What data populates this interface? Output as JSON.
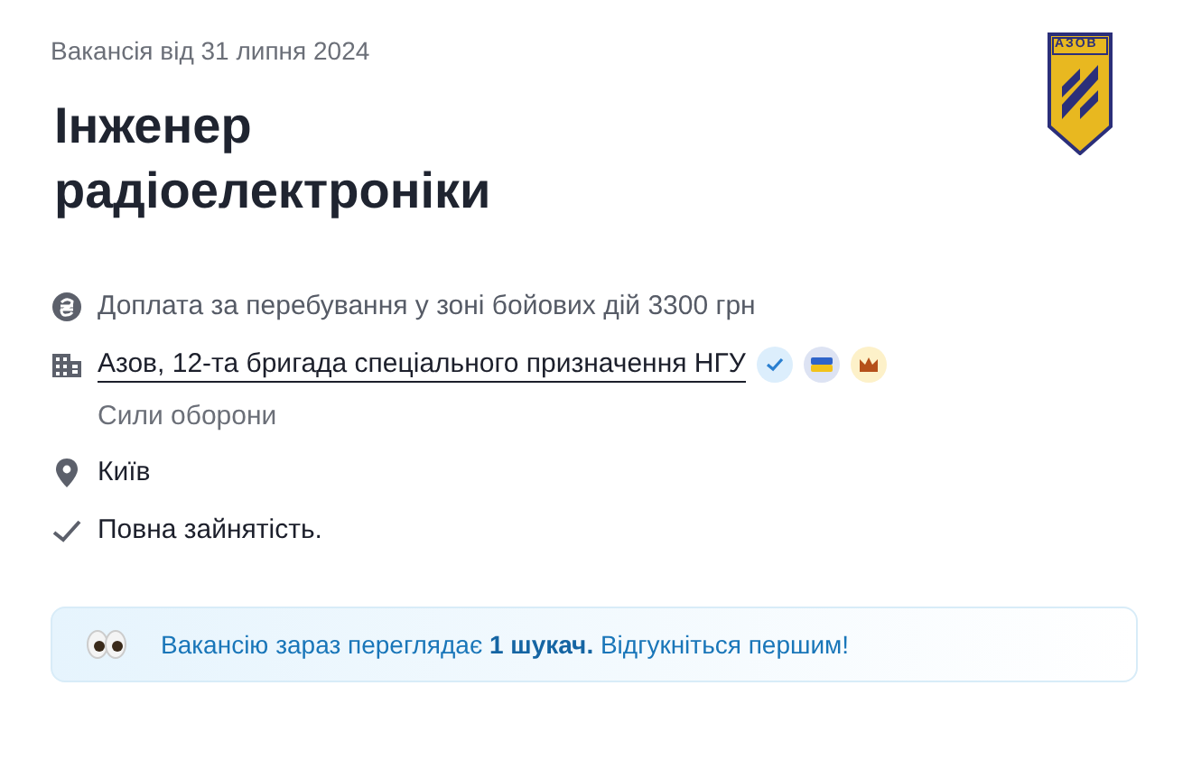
{
  "date": "Вакансія від 31 липня 2024",
  "title": "Інженер радіоелектроніки",
  "logo": {
    "text": "АЗОВ"
  },
  "details": [
    {
      "kind": "salary",
      "text": "Доплата за перебування у зоні бойових дій 3300 грн"
    },
    {
      "kind": "company",
      "text": "Азов, 12-та бригада спеціального призначення НГУ",
      "subtext": "Сили оборони",
      "badges": [
        {
          "kind": "verified"
        },
        {
          "kind": "ukraine"
        },
        {
          "kind": "premium"
        }
      ]
    },
    {
      "kind": "location",
      "text": "Київ"
    },
    {
      "kind": "employment",
      "text": "Повна зайнятість."
    }
  ],
  "notice": "Вакансію зараз переглядає **1 шукач.** Відгукніться першим!"
}
